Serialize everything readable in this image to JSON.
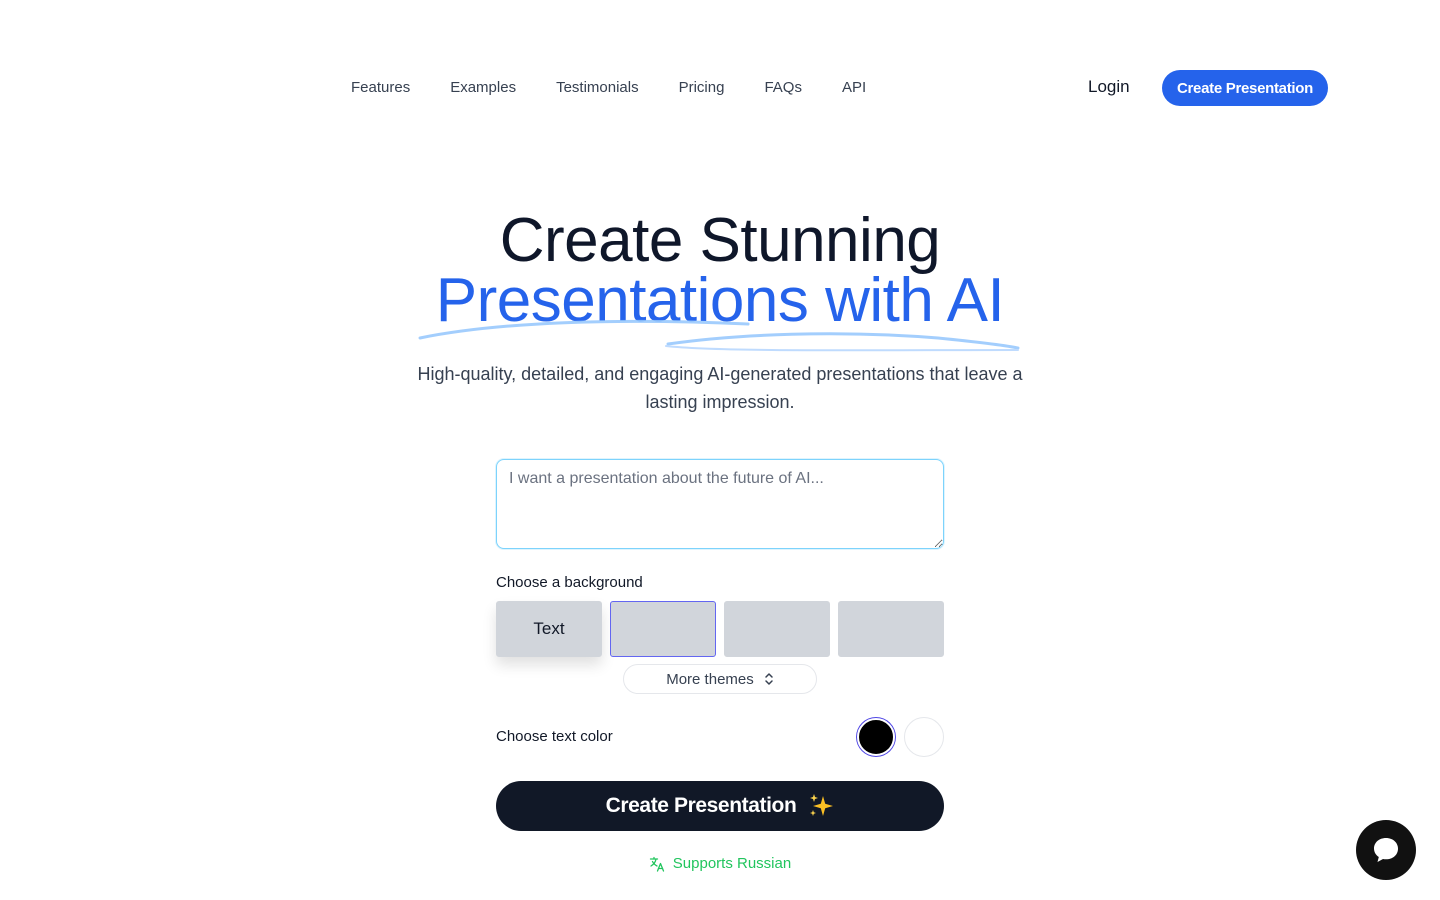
{
  "nav": {
    "links": [
      {
        "label": "Features"
      },
      {
        "label": "Examples"
      },
      {
        "label": "Testimonials"
      },
      {
        "label": "Pricing"
      },
      {
        "label": "FAQs"
      },
      {
        "label": "API"
      }
    ],
    "login_label": "Login",
    "cta_label": "Create Presentation"
  },
  "hero": {
    "title_line1": "Create Stunning",
    "title_line2": "Presentations with AI",
    "subtitle": "High-quality, detailed, and engaging AI-generated presentations that leave a lasting impression."
  },
  "prompt": {
    "placeholder": "I want a presentation about the future of AI...",
    "value": ""
  },
  "background": {
    "label": "Choose a background",
    "tiles": [
      {
        "label": "Text"
      },
      {
        "label": ""
      },
      {
        "label": ""
      },
      {
        "label": ""
      }
    ],
    "selected_index": 1,
    "more_label": "More themes",
    "more_icon": "chevron-up-down-icon"
  },
  "text_color": {
    "label": "Choose text color",
    "options": [
      "#000000",
      "#ffffff"
    ],
    "selected": "#000000"
  },
  "create_button": {
    "label": "Create Presentation",
    "icon": "sparkles-icon"
  },
  "supports": {
    "label": "Supports Russian",
    "icon": "translate-icon"
  },
  "chat": {
    "icon": "chat-bubble-icon"
  },
  "colors": {
    "accent": "#2563eb",
    "dark": "#111827",
    "success": "#22c55e"
  }
}
